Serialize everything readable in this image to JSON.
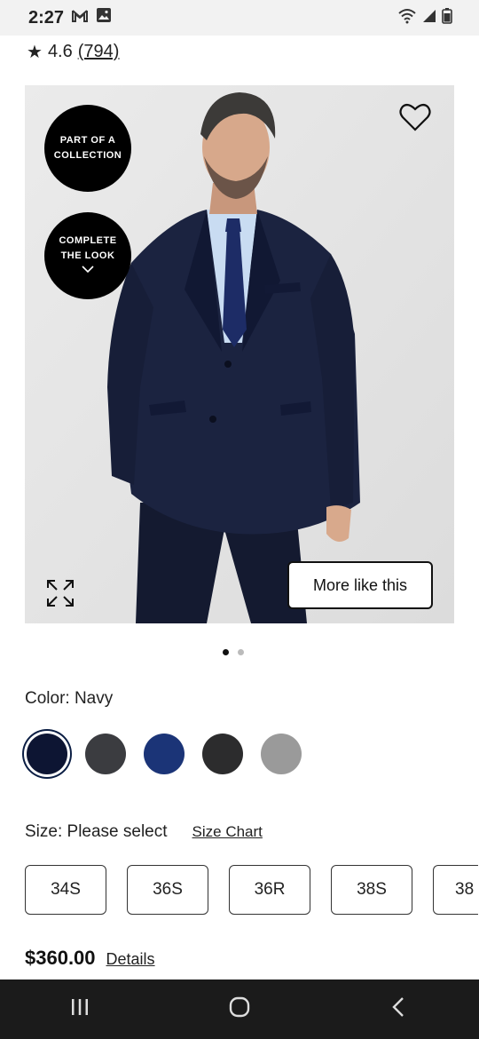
{
  "status_bar": {
    "time": "2:27",
    "icons": [
      "gmail-icon",
      "gallery-icon",
      "wifi-icon",
      "signal-icon",
      "battery-icon"
    ]
  },
  "rating": {
    "star": "★",
    "value": "4.6",
    "count": "(794)"
  },
  "hero": {
    "badge_collection_line1": "PART OF A",
    "badge_collection_line2": "COLLECTION",
    "badge_look_line1": "COMPLETE",
    "badge_look_line2": "THE LOOK",
    "more_like_label": "More like this"
  },
  "carousel": {
    "total": 2,
    "active": 1
  },
  "color": {
    "label": "Color: Navy",
    "swatches": [
      {
        "name": "Navy",
        "hex": "#0d1533",
        "selected": true
      },
      {
        "name": "Charcoal",
        "hex": "#3b3c40",
        "selected": false
      },
      {
        "name": "Blue",
        "hex": "#1b3477",
        "selected": false
      },
      {
        "name": "Black",
        "hex": "#2c2c2d",
        "selected": false
      },
      {
        "name": "Gray",
        "hex": "#9a9a9a",
        "selected": false
      }
    ]
  },
  "size": {
    "label": "Size: Please select",
    "chart_link": "Size Chart",
    "options": [
      "34S",
      "36S",
      "36R",
      "38S",
      "38"
    ]
  },
  "price": {
    "amount": "$360.00",
    "details_link": "Details"
  }
}
